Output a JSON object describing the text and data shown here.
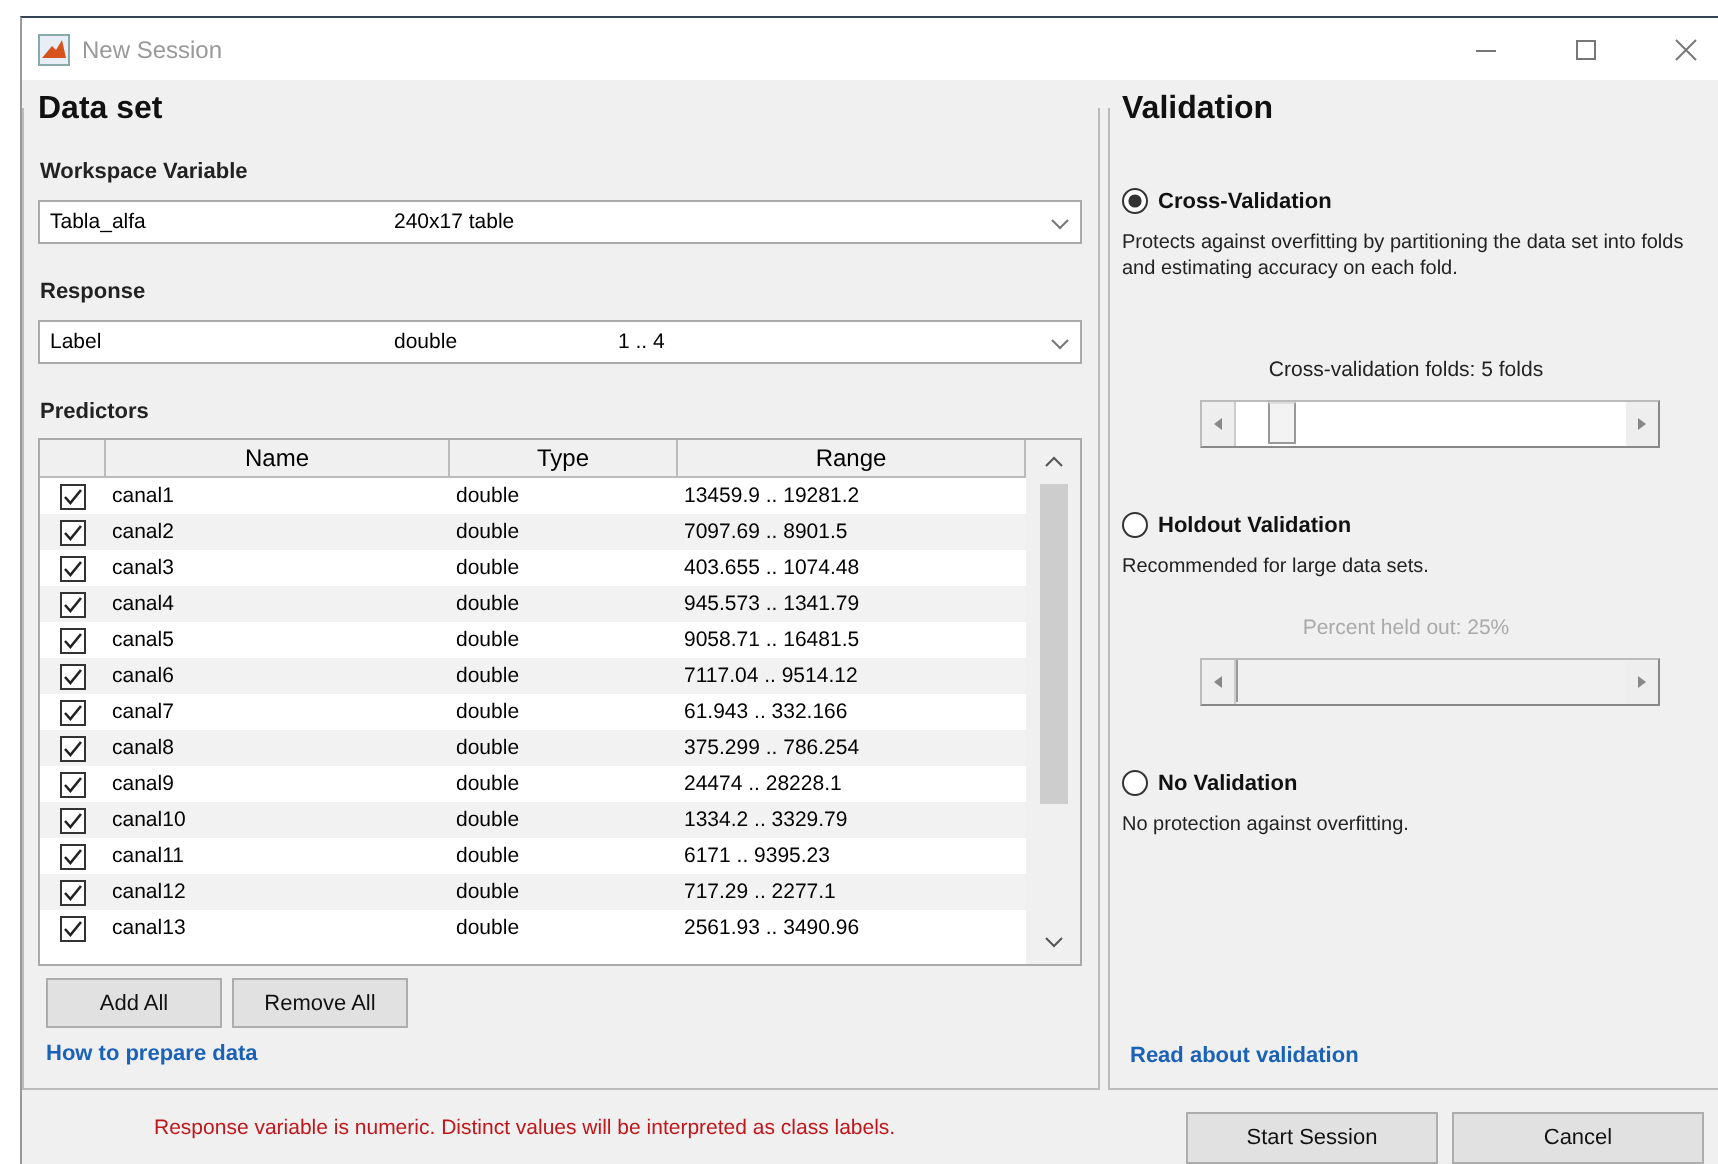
{
  "window": {
    "title": "New Session"
  },
  "data_set": {
    "title": "Data set",
    "workspace_variable": {
      "label": "Workspace Variable",
      "values": [
        "Tabla_alfa",
        "240x17 table"
      ]
    },
    "response": {
      "label": "Response",
      "values": [
        "Label",
        "double",
        "1 .. 4"
      ]
    },
    "predictors": {
      "label": "Predictors",
      "columns": [
        "Name",
        "Type",
        "Range"
      ],
      "rows": [
        {
          "checked": true,
          "name": "canal1",
          "type": "double",
          "range": "13459.9 .. 19281.2"
        },
        {
          "checked": true,
          "name": "canal2",
          "type": "double",
          "range": "7097.69 .. 8901.5"
        },
        {
          "checked": true,
          "name": "canal3",
          "type": "double",
          "range": "403.655 .. 1074.48"
        },
        {
          "checked": true,
          "name": "canal4",
          "type": "double",
          "range": "945.573 .. 1341.79"
        },
        {
          "checked": true,
          "name": "canal5",
          "type": "double",
          "range": "9058.71 .. 16481.5"
        },
        {
          "checked": true,
          "name": "canal6",
          "type": "double",
          "range": "7117.04 .. 9514.12"
        },
        {
          "checked": true,
          "name": "canal7",
          "type": "double",
          "range": "61.943 .. 332.166"
        },
        {
          "checked": true,
          "name": "canal8",
          "type": "double",
          "range": "375.299 .. 786.254"
        },
        {
          "checked": true,
          "name": "canal9",
          "type": "double",
          "range": "24474 .. 28228.1"
        },
        {
          "checked": true,
          "name": "canal10",
          "type": "double",
          "range": "1334.2 .. 3329.79"
        },
        {
          "checked": true,
          "name": "canal11",
          "type": "double",
          "range": "6171 .. 9395.23"
        },
        {
          "checked": true,
          "name": "canal12",
          "type": "double",
          "range": "717.29 .. 2277.1"
        },
        {
          "checked": true,
          "name": "canal13",
          "type": "double",
          "range": "2561.93 .. 3490.96"
        }
      ]
    },
    "buttons": [
      "Add All",
      "Remove All"
    ],
    "link": "How to prepare data"
  },
  "validation": {
    "title": "Validation",
    "options": [
      {
        "label": "Cross-Validation",
        "selected": true,
        "description": "Protects against overfitting by partitioning the data set into folds and estimating accuracy on each fold.",
        "slider": {
          "label": "Cross-validation folds: 5 folds",
          "disabled": false,
          "level": 0.08
        }
      },
      {
        "label": "Holdout Validation",
        "selected": false,
        "description": "Recommended for large data sets.",
        "slider": {
          "label": "Percent held out: 25%",
          "disabled": true,
          "level": 0
        }
      },
      {
        "label": "No Validation",
        "selected": false,
        "description": "No protection against overfitting."
      }
    ],
    "link": "Read about validation"
  },
  "message": "Response variable is numeric. Distinct values will be interpreted as class labels.",
  "buttons": [
    "Start Session",
    "Cancel"
  ]
}
